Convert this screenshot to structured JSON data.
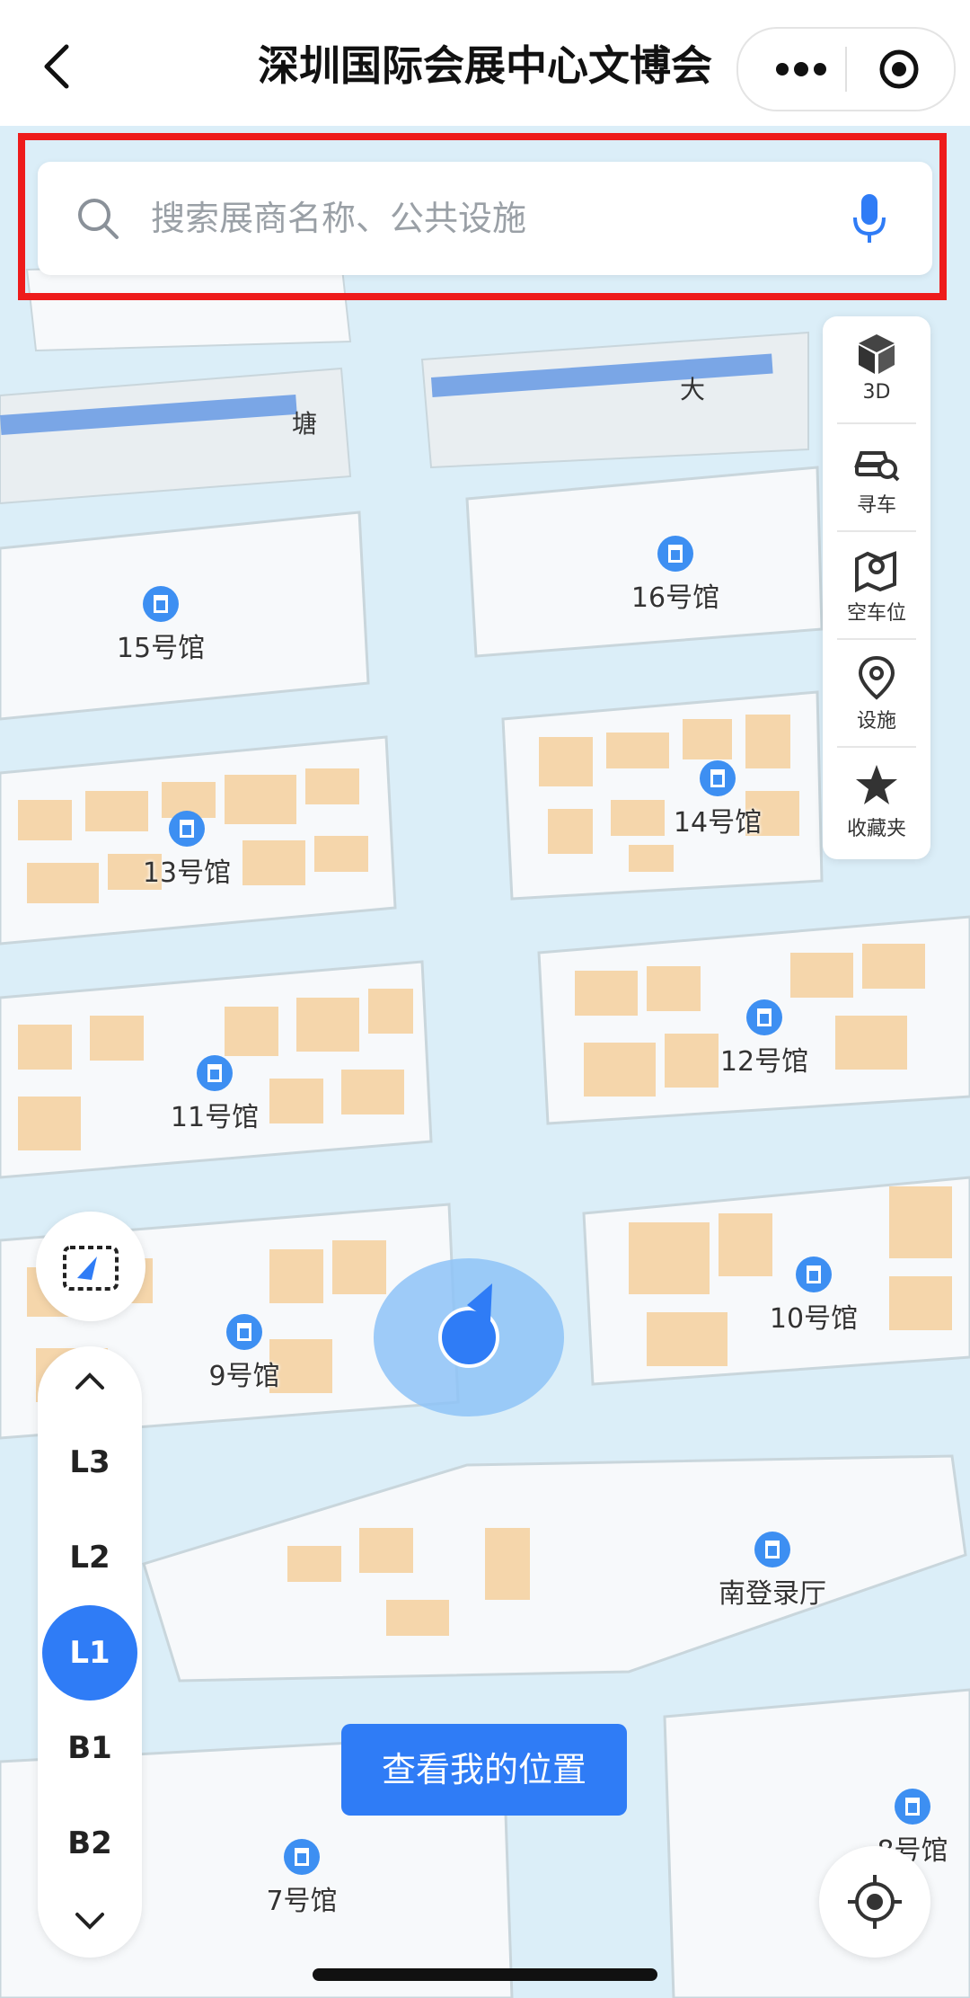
{
  "header": {
    "title": "深圳国际会展中心文博会"
  },
  "search": {
    "placeholder": "搜索展商名称、公共设施"
  },
  "tools": [
    {
      "label": "3D",
      "icon": "cube-3d-icon"
    },
    {
      "label": "寻车",
      "icon": "find-car-icon"
    },
    {
      "label": "空车位",
      "icon": "parking-map-icon"
    },
    {
      "label": "设施",
      "icon": "location-pin-icon"
    },
    {
      "label": "收藏夹",
      "icon": "star-favorite-icon"
    }
  ],
  "floors": {
    "levels": [
      "L3",
      "L2",
      "L1",
      "B1",
      "B2"
    ],
    "active": "L1"
  },
  "halls": [
    "15号馆",
    "16号馆",
    "14号馆",
    "13号馆",
    "12号馆",
    "11号馆",
    "10号馆",
    "9号馆",
    "南登录厅",
    "8号馆",
    "7号馆"
  ],
  "streets": [
    "塘",
    "大"
  ],
  "location_button": "查看我的位置",
  "colors": {
    "accent": "#2f7cf6",
    "highlight_border": "#ee1b1b",
    "booth": "#f5d6ab",
    "hall": "#f7f9fb",
    "corridor": "#dbeef8"
  }
}
